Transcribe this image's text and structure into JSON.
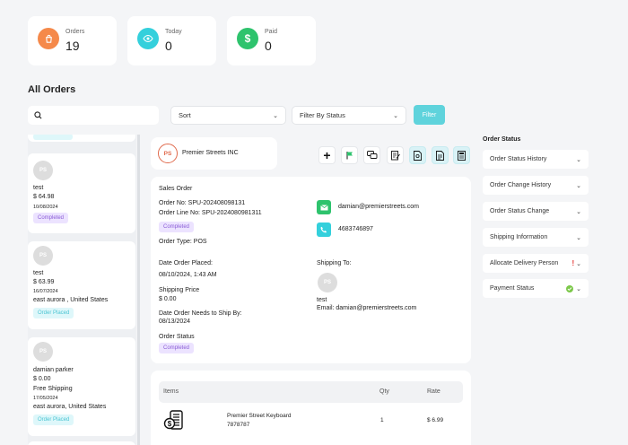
{
  "stats": [
    {
      "label": "Orders",
      "value": "19",
      "color": "#f5894a"
    },
    {
      "label": "Today",
      "value": "0",
      "color": "#34d0dc"
    },
    {
      "label": "Paid",
      "value": "0",
      "color": "#2ec36d"
    }
  ],
  "page_title": "All Orders",
  "toolbar": {
    "sort_label": "Sort",
    "status_label": "Filter By Status",
    "filter_label": "Filter"
  },
  "order_list": [
    {
      "initials": "PS",
      "name": "test",
      "price": "$ 64.98",
      "date": "10/08/2024",
      "location": "",
      "status": "Completed"
    },
    {
      "initials": "PS",
      "name": "test",
      "price": "$ 63.99",
      "date": "16/07/2024",
      "location": "east aurora , United States",
      "status": "Order Placed"
    },
    {
      "initials": "PS",
      "name": "damian parker",
      "price": "$ 0.00",
      "shipping": "Free Shipping",
      "date": "17/05/2024",
      "location": "east aurora, United States",
      "status": "Order Placed"
    }
  ],
  "store": {
    "initials": "PS",
    "name": "Premier Streets INC"
  },
  "sales_order": {
    "heading": "Sales Order",
    "order_no": "Order No: SPU-20240809813​1",
    "order_line_no": "Order Line No: SPU-2024080981311",
    "status": "Completed",
    "order_type": "Order Type: POS",
    "email": "damian@premierstreets.com",
    "phone": "4683746897",
    "date_placed_label": "Date Order Placed:",
    "date_placed": "08/10/2024, 1:43 AM",
    "shipping_price_label": "Shipping Price",
    "shipping_price": "$ 0.00",
    "ship_by_label": "Date Order Needs to Ship By:",
    "ship_by": "08/13/2024",
    "order_status_label": "Order Status",
    "order_status": "Completed",
    "shipping_to_label": "Shipping To:",
    "ship_initials": "PS",
    "ship_name": "test",
    "ship_email": "Email: damian@premierstreets.com"
  },
  "items_table": {
    "headers": [
      "Items",
      "Qty",
      "Rate"
    ],
    "rows": [
      {
        "name": "Premier Street Keyboard",
        "sku": "7878787",
        "qty": "1",
        "rate": "$ 6.99"
      }
    ]
  },
  "status_panel": {
    "title": "Order Status",
    "sections": [
      {
        "label": "Order Status History",
        "flag": ""
      },
      {
        "label": "Order Change History",
        "flag": ""
      },
      {
        "label": "Order Status Change",
        "flag": ""
      },
      {
        "label": "Shipping Information",
        "flag": ""
      },
      {
        "label": "Allocate Delivery Person",
        "flag": "!"
      },
      {
        "label": "Payment Status",
        "flag": "ok"
      }
    ]
  }
}
